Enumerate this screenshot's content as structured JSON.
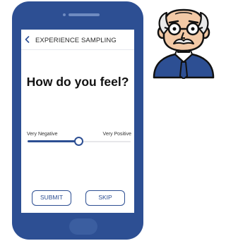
{
  "screen": {
    "header": {
      "title": "EXPERIENCE SAMPLING"
    },
    "question": "How do you feel?",
    "slider": {
      "min_label": "Very Negative",
      "max_label": "Very Positive",
      "value": 0.5
    },
    "buttons": {
      "submit": "SUBMIT",
      "skip": "SKIP"
    }
  },
  "colors": {
    "phone": "#2d4f93",
    "accent": "#2d4f93",
    "avatar_jacket": "#2d4f93",
    "avatar_skin": "#f2c9a6"
  },
  "icons": {
    "back": "chevron-left-icon",
    "avatar": "elderly-man-avatar-icon"
  }
}
